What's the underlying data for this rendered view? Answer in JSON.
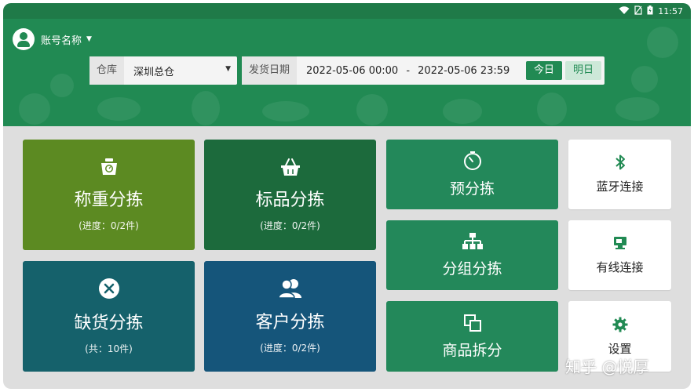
{
  "status_bar": {
    "time": "11:57",
    "icons": [
      "wifi-icon",
      "no-sim-icon",
      "battery-icon"
    ]
  },
  "header": {
    "account_name": "账号名称",
    "warehouse": {
      "label": "仓库",
      "value": "深圳总仓"
    },
    "ship_date": {
      "label": "发货日期",
      "start": "2022-05-06 00:00",
      "separator": "-",
      "end": "2022-05-06 23:59",
      "today_label": "今日",
      "tomorrow_label": "明日"
    }
  },
  "tiles": {
    "weigh_sort": {
      "title": "称重分拣",
      "sub": "(进度：0/2件)",
      "icon": "scale-icon",
      "color": "#5c8a22"
    },
    "standard_sort": {
      "title": "标品分拣",
      "sub": "(进度：0/2件)",
      "icon": "basket-icon",
      "color": "#1c6a3c"
    },
    "shortage_sort": {
      "title": "缺货分拣",
      "sub": "(共：10件)",
      "icon": "cancel-circle-icon",
      "color": "#15616b"
    },
    "customer_sort": {
      "title": "客户分拣",
      "sub": "(进度：0/2件)",
      "icon": "users-icon",
      "color": "#15557a"
    },
    "pre_sort": {
      "title": "预分拣",
      "icon": "timer-icon",
      "color": "#23885a"
    },
    "group_sort": {
      "title": "分组分拣",
      "icon": "hierarchy-icon",
      "color": "#23885a"
    },
    "product_split": {
      "title": "商品拆分",
      "icon": "copy-icon",
      "color": "#23885a"
    },
    "bluetooth": {
      "title": "蓝牙连接",
      "icon": "bluetooth-icon"
    },
    "wired": {
      "title": "有线连接",
      "icon": "wired-device-icon"
    },
    "settings": {
      "title": "设置",
      "icon": "gear-icon"
    }
  },
  "watermark": "知乎 @悦厚"
}
